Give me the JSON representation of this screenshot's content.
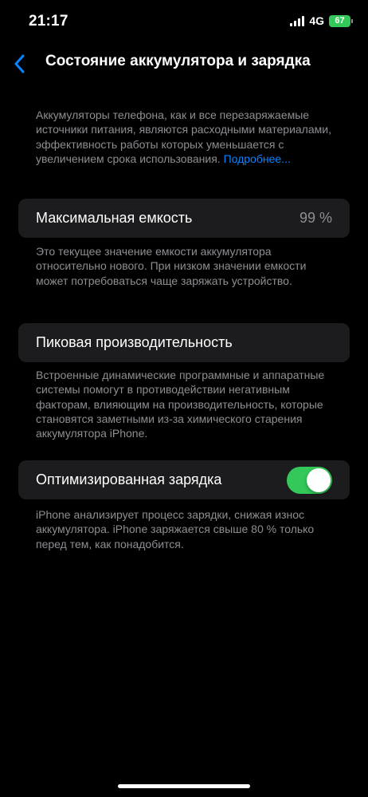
{
  "status_bar": {
    "time": "21:17",
    "network": "4G",
    "battery_percent": "67",
    "battery_color": "#34c759"
  },
  "nav": {
    "back_icon": "chevron-left-icon",
    "title": "Состояние аккумулятора и зарядка"
  },
  "intro": {
    "text": "Аккумуляторы телефона, как и все перезаряжаемые источники питания, являются расходными материалами, эффективность работы которых уменьшается с увеличением срока использования. ",
    "link": "Подробнее..."
  },
  "max_capacity": {
    "label": "Максимальная емкость",
    "value": "99 %",
    "footnote": "Это текущее значение емкости аккумулятора относительно нового. При низком значении емкости может потребоваться чаще заряжать устройство."
  },
  "peak_performance": {
    "label": "Пиковая производительность",
    "footnote": "Встроенные динамические программные и аппаратные системы помогут в противодействии негативным факторам, влияющим на производительность, которые становятся заметными из-за химического старения аккумулятора iPhone."
  },
  "optimized_charging": {
    "label": "Оптимизированная зарядка",
    "enabled": true,
    "toggle_color": "#34c759",
    "footnote": "iPhone анализирует процесс зарядки, снижая износ аккумулятора. iPhone заряжается свыше 80 % только перед тем, как понадобится."
  },
  "colors": {
    "accent": "#0a84ff",
    "card_background": "#1c1c1e",
    "secondary_text": "#8e8e93"
  }
}
